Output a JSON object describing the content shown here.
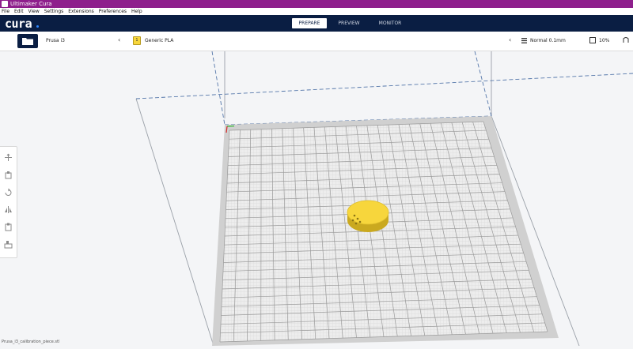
{
  "window": {
    "title": "Ultimaker Cura"
  },
  "menu": [
    "File",
    "Edit",
    "View",
    "Settings",
    "Extensions",
    "Preferences",
    "Help"
  ],
  "header": {
    "logo": "cura",
    "tabs": [
      {
        "label": "PREPARE",
        "active": true
      },
      {
        "label": "PREVIEW",
        "active": false
      },
      {
        "label": "MONITOR",
        "active": false
      }
    ]
  },
  "toolbar": {
    "printer": "Prusa i3",
    "material_badge": "1",
    "material": "Generic PLA",
    "profile": "Normal 0.1mm",
    "infill": "10%"
  },
  "colors": {
    "header_bg": "#0a1e43",
    "title_bg": "#8e1f8c",
    "model": "#f7d63c",
    "accent": "#2d88ff"
  },
  "side_tools": [
    "move-tool-icon",
    "scale-tool-icon",
    "rotate-tool-icon",
    "mirror-tool-icon",
    "per-model-settings-icon",
    "support-blocker-icon"
  ],
  "statusbar": {
    "text": "Prusa_i3_calibration_piece.stl"
  }
}
